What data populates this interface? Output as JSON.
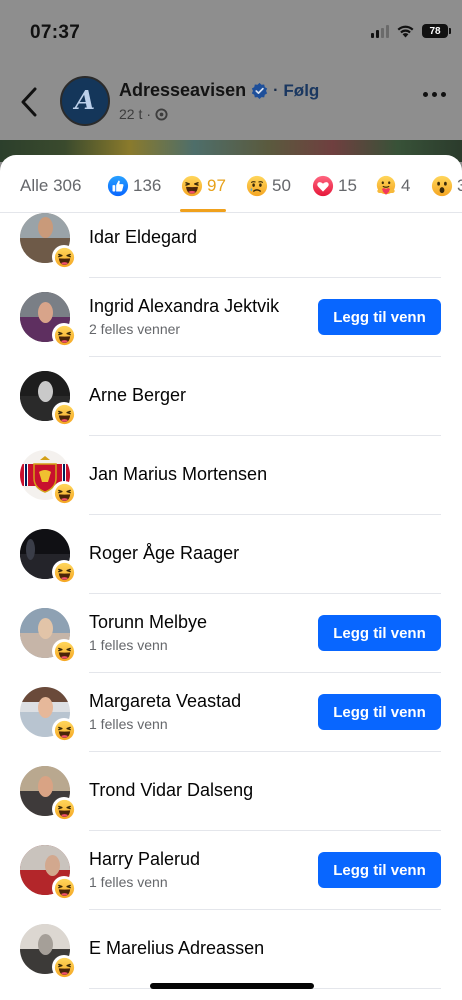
{
  "status_bar": {
    "time": "07:37",
    "battery": "78"
  },
  "page": {
    "name": "Adresseavisen",
    "separator": "·",
    "follow_label": "Følg",
    "meta_time": "22 t",
    "meta_separator": "·",
    "avatar_letter": "A"
  },
  "tabs": [
    {
      "label": "Alle 306",
      "icon": null,
      "active": false
    },
    {
      "label": "136",
      "icon": "like-icon",
      "active": false
    },
    {
      "label": "97",
      "icon": "haha-icon",
      "active": true
    },
    {
      "label": "50",
      "icon": "sad-icon",
      "active": false
    },
    {
      "label": "15",
      "icon": "love-icon",
      "active": false
    },
    {
      "label": "4",
      "icon": "care-icon",
      "active": false
    },
    {
      "label": "3",
      "icon": "wow-icon",
      "active": false
    }
  ],
  "people": [
    {
      "name": "Idar Eldegard",
      "subtitle": "",
      "button": "",
      "reaction": "haha-icon"
    },
    {
      "name": "Ingrid Alexandra Jektvik",
      "subtitle": "2 felles venner",
      "button": "Legg til venn",
      "reaction": "haha-icon"
    },
    {
      "name": "Arne Berger",
      "subtitle": "",
      "button": "",
      "reaction": "haha-icon"
    },
    {
      "name": "Jan Marius Mortensen",
      "subtitle": "",
      "button": "",
      "reaction": "haha-icon"
    },
    {
      "name": "Roger Åge Raager",
      "subtitle": "",
      "button": "",
      "reaction": "haha-icon"
    },
    {
      "name": "Torunn Melbye",
      "subtitle": "1 felles venn",
      "button": "Legg til venn",
      "reaction": "haha-icon"
    },
    {
      "name": "Margareta Veastad",
      "subtitle": "1 felles venn",
      "button": "Legg til venn",
      "reaction": "haha-icon"
    },
    {
      "name": "Trond Vidar Dalseng",
      "subtitle": "",
      "button": "",
      "reaction": "haha-icon"
    },
    {
      "name": "Harry Palerud",
      "subtitle": "1 felles venn",
      "button": "Legg til venn",
      "reaction": "haha-icon"
    },
    {
      "name": "E Marelius Adreassen",
      "subtitle": "",
      "button": "",
      "reaction": "haha-icon"
    }
  ],
  "colors": {
    "accent_blue": "#0866ff",
    "active_tab": "#e7a21c",
    "secondary_text": "#65676b",
    "divider": "#e4e6eb"
  }
}
